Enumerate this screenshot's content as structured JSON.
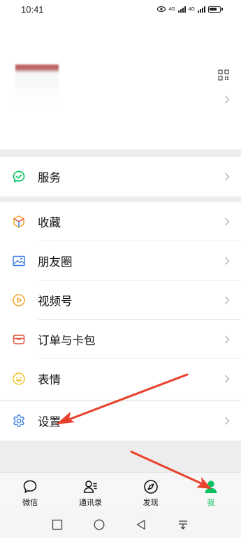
{
  "status_bar": {
    "time": "10:41",
    "signal_label_1": "4G",
    "signal_label_2": "4G"
  },
  "menu_groups": [
    {
      "items": [
        {
          "label": "服务",
          "icon": "service-icon"
        }
      ]
    },
    {
      "items": [
        {
          "label": "收藏",
          "icon": "favorites-cube-icon"
        },
        {
          "label": "朋友圈",
          "icon": "moments-image-icon"
        },
        {
          "label": "视频号",
          "icon": "channels-play-icon"
        },
        {
          "label": "订单与卡包",
          "icon": "orders-card-icon"
        },
        {
          "label": "表情",
          "icon": "sticker-smiley-icon"
        }
      ]
    },
    {
      "items": [
        {
          "label": "设置",
          "icon": "settings-gear-icon"
        }
      ]
    }
  ],
  "tabs": [
    {
      "label": "微信",
      "icon": "chat-bubble-icon",
      "active": false
    },
    {
      "label": "通讯录",
      "icon": "contacts-icon",
      "active": false
    },
    {
      "label": "发现",
      "icon": "discover-compass-icon",
      "active": false
    },
    {
      "label": "我",
      "icon": "me-person-icon",
      "active": true
    }
  ],
  "colors": {
    "accent": "#07c160",
    "annotation_arrow": "#e8412c",
    "page_bg": "#ededed"
  }
}
